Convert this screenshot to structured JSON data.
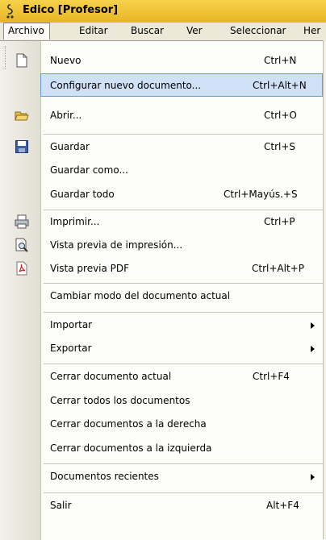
{
  "window": {
    "title": "Edico [Profesor]"
  },
  "menubar": {
    "items": [
      {
        "label": "Archivo"
      },
      {
        "label": "Editar"
      },
      {
        "label": "Buscar"
      },
      {
        "label": "Ver"
      },
      {
        "label": "Seleccionar"
      },
      {
        "label": "Her"
      }
    ]
  },
  "menu": {
    "items": [
      {
        "label": "Nuevo",
        "shortcut": "Ctrl+N",
        "icon": "new-document-icon"
      },
      {
        "label": "Configurar nuevo documento...",
        "shortcut": "Ctrl+Alt+N",
        "highlighted": true
      },
      {
        "label": "Abrir...",
        "shortcut": "Ctrl+O",
        "icon": "open-folder-icon"
      },
      {
        "label": "Guardar",
        "shortcut": "Ctrl+S",
        "icon": "save-disk-icon"
      },
      {
        "label": "Guardar como..."
      },
      {
        "label": "Guardar todo",
        "shortcut": "Ctrl+Mayús.+S"
      },
      {
        "label": "Imprimir...",
        "shortcut": "Ctrl+P",
        "icon": "printer-icon"
      },
      {
        "label": "Vista previa de impresión...",
        "icon": "print-preview-icon"
      },
      {
        "label": "Vista previa PDF",
        "shortcut": "Ctrl+Alt+P",
        "icon": "pdf-icon"
      },
      {
        "label": "Cambiar modo del documento actual"
      },
      {
        "label": "Importar",
        "submenu": true
      },
      {
        "label": "Exportar",
        "submenu": true
      },
      {
        "label": "Cerrar documento actual",
        "shortcut": "Ctrl+F4"
      },
      {
        "label": "Cerrar todos los documentos"
      },
      {
        "label": "Cerrar documentos a la derecha"
      },
      {
        "label": "Cerrar documentos a la izquierda"
      },
      {
        "label": "Documentos recientes",
        "submenu": true
      },
      {
        "label": "Salir",
        "shortcut": "Alt+F4"
      }
    ]
  },
  "colors": {
    "titlebar": "#f2c83a",
    "highlight": "#cfe0f7",
    "highlight_border": "#6b9bd6"
  }
}
